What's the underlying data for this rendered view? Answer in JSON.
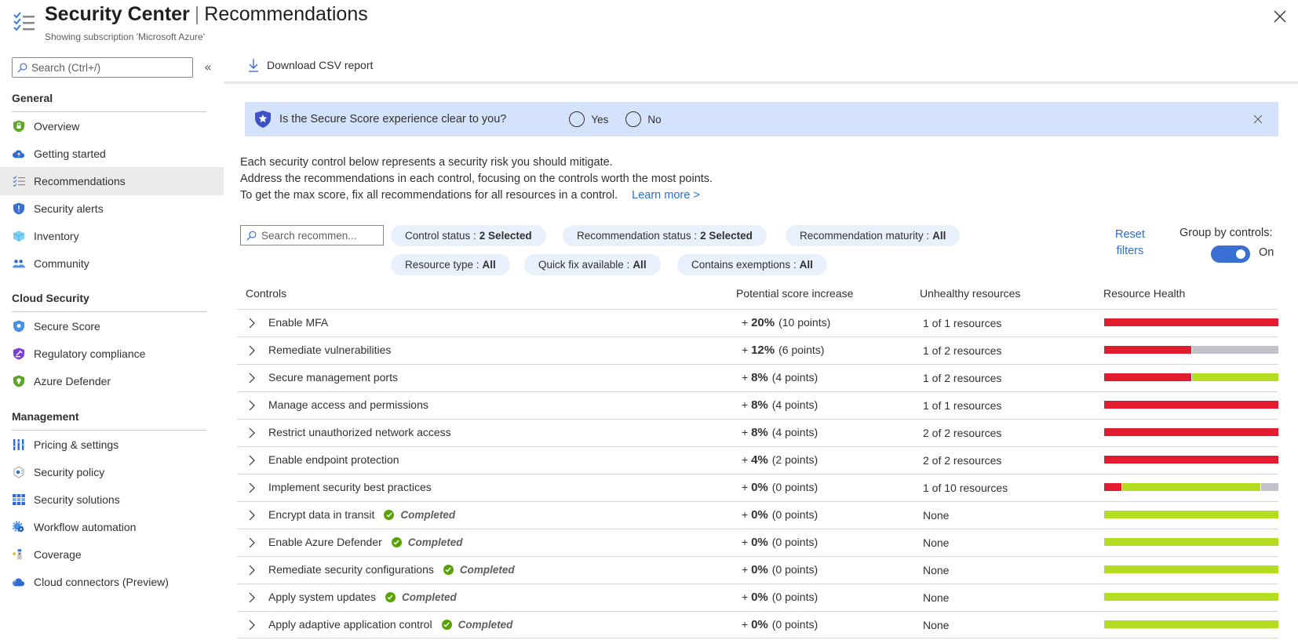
{
  "header": {
    "title_bold": "Security Center",
    "title_separator": "|",
    "title_light": "Recommendations",
    "subtitle": "Showing subscription 'Microsoft Azure'"
  },
  "sidebar": {
    "search_placeholder": "Search (Ctrl+/)",
    "collapse_glyph": "«",
    "sections": [
      {
        "label": "General",
        "items": [
          {
            "label": "Overview",
            "icon": "shield-lock-icon"
          },
          {
            "label": "Getting started",
            "icon": "cloud-upload-icon"
          },
          {
            "label": "Recommendations",
            "icon": "checklist-icon",
            "active": true
          },
          {
            "label": "Security alerts",
            "icon": "shield-alert-icon"
          },
          {
            "label": "Inventory",
            "icon": "cube-icon"
          },
          {
            "label": "Community",
            "icon": "people-icon"
          }
        ]
      },
      {
        "label": "Cloud Security",
        "items": [
          {
            "label": "Secure Score",
            "icon": "shield-star-icon"
          },
          {
            "label": "Regulatory compliance",
            "icon": "shield-gavel-icon"
          },
          {
            "label": "Azure Defender",
            "icon": "shield-bulb-icon"
          }
        ]
      },
      {
        "label": "Management",
        "items": [
          {
            "label": "Pricing & settings",
            "icon": "sliders-icon"
          },
          {
            "label": "Security policy",
            "icon": "policy-icon"
          },
          {
            "label": "Security solutions",
            "icon": "grid-icon"
          },
          {
            "label": "Workflow automation",
            "icon": "gear-play-icon"
          },
          {
            "label": "Coverage",
            "icon": "lighthouse-icon"
          },
          {
            "label": "Cloud connectors (Preview)",
            "icon": "cloud-icon"
          }
        ]
      }
    ]
  },
  "toolbar": {
    "download_label": "Download CSV report"
  },
  "banner": {
    "question": "Is the Secure Score experience clear to you?",
    "yes_label": "Yes",
    "no_label": "No"
  },
  "description": {
    "line1": "Each security control below represents a security risk you should mitigate.",
    "line2": "Address the recommendations in each control, focusing on the controls worth the most points.",
    "line3": "To get the max score, fix all recommendations for all resources in a control.",
    "learn_more": "Learn more >"
  },
  "filters": {
    "search_placeholder": "Search recommen...",
    "pills": [
      {
        "label": "Control status :",
        "value": "2 Selected"
      },
      {
        "label": "Recommendation status :",
        "value": "2 Selected"
      },
      {
        "label": "Recommendation maturity :",
        "value": "All"
      },
      {
        "label": "Resource type :",
        "value": "All"
      },
      {
        "label": "Quick fix available :",
        "value": "All"
      },
      {
        "label": "Contains exemptions :",
        "value": "All"
      }
    ],
    "reset_line1": "Reset",
    "reset_line2": "filters",
    "group_by_label": "Group by controls:",
    "group_by_state": "On",
    "group_by_on": true
  },
  "table": {
    "headers": {
      "controls": "Controls",
      "score": "Potential score increase",
      "unhealthy": "Unhealthy resources",
      "health": "Resource Health"
    },
    "colors": {
      "unhealthy": "#e31b2e",
      "healthy": "#b4dd22",
      "not_applicable": "#c1c1c9"
    },
    "completed_label": "Completed",
    "rows": [
      {
        "name": "Enable MFA",
        "completed": false,
        "pct": "20%",
        "points": "(10 points)",
        "unhealthy": "1 of 1 resources",
        "health": {
          "unhealthy": 1,
          "healthy": 0,
          "na": 0
        }
      },
      {
        "name": "Remediate vulnerabilities",
        "completed": false,
        "pct": "12%",
        "points": "(6 points)",
        "unhealthy": "1 of 2 resources",
        "health": {
          "unhealthy": 1,
          "healthy": 0,
          "na": 1
        }
      },
      {
        "name": "Secure management ports",
        "completed": false,
        "pct": "8%",
        "points": "(4 points)",
        "unhealthy": "1 of 2 resources",
        "health": {
          "unhealthy": 1,
          "healthy": 1,
          "na": 0
        }
      },
      {
        "name": "Manage access and permissions",
        "completed": false,
        "pct": "8%",
        "points": "(4 points)",
        "unhealthy": "1 of 1 resources",
        "health": {
          "unhealthy": 1,
          "healthy": 0,
          "na": 0
        }
      },
      {
        "name": "Restrict unauthorized network access",
        "completed": false,
        "pct": "8%",
        "points": "(4 points)",
        "unhealthy": "2 of 2 resources",
        "health": {
          "unhealthy": 2,
          "healthy": 0,
          "na": 0
        }
      },
      {
        "name": "Enable endpoint protection",
        "completed": false,
        "pct": "4%",
        "points": "(2 points)",
        "unhealthy": "2 of 2 resources",
        "health": {
          "unhealthy": 2,
          "healthy": 0,
          "na": 0
        }
      },
      {
        "name": "Implement security best practices",
        "completed": false,
        "pct": "0%",
        "points": "(0 points)",
        "unhealthy": "1 of 10 resources",
        "health": {
          "unhealthy": 1,
          "healthy": 8,
          "na": 1
        }
      },
      {
        "name": "Encrypt data in transit",
        "completed": true,
        "pct": "0%",
        "points": "(0 points)",
        "unhealthy": "None",
        "health": {
          "unhealthy": 0,
          "healthy": 1,
          "na": 0
        }
      },
      {
        "name": "Enable Azure Defender",
        "completed": true,
        "pct": "0%",
        "points": "(0 points)",
        "unhealthy": "None",
        "health": {
          "unhealthy": 0,
          "healthy": 1,
          "na": 0
        }
      },
      {
        "name": "Remediate security configurations",
        "completed": true,
        "pct": "0%",
        "points": "(0 points)",
        "unhealthy": "None",
        "health": {
          "unhealthy": 0,
          "healthy": 1,
          "na": 0
        }
      },
      {
        "name": "Apply system updates",
        "completed": true,
        "pct": "0%",
        "points": "(0 points)",
        "unhealthy": "None",
        "health": {
          "unhealthy": 0,
          "healthy": 1,
          "na": 0
        }
      },
      {
        "name": "Apply adaptive application control",
        "completed": true,
        "pct": "0%",
        "points": "(0 points)",
        "unhealthy": "None",
        "health": {
          "unhealthy": 0,
          "healthy": 1,
          "na": 0
        }
      }
    ]
  }
}
